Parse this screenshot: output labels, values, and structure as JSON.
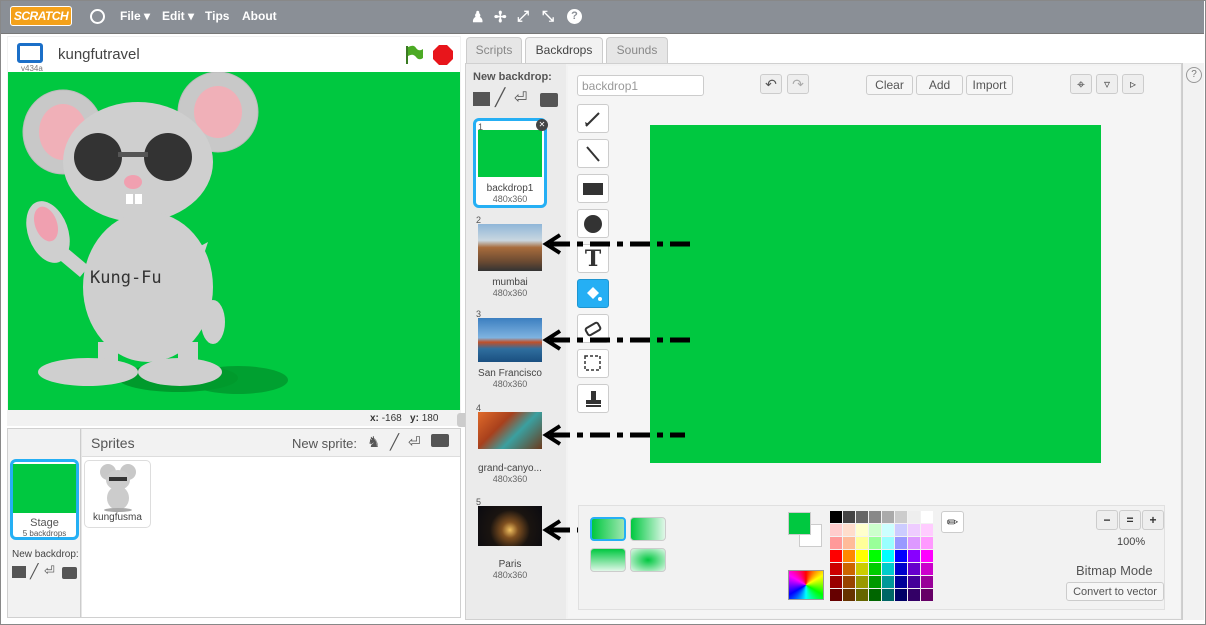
{
  "menubar": {
    "logo": "SCRATCH",
    "items": [
      "File ▾",
      "Edit ▾",
      "Tips",
      "About"
    ]
  },
  "stage": {
    "project_title": "kungfutravel",
    "version": "v434a",
    "sprite_text": "Kung-Fu",
    "coords_x_label": "x:",
    "coords_x": "-168",
    "coords_y_label": "y:",
    "coords_y": "180"
  },
  "sprites_panel": {
    "title": "Sprites",
    "new_sprite_label": "New sprite:",
    "stage_label": "Stage",
    "stage_backdrops": "5 backdrops",
    "new_backdrop_label": "New backdrop:",
    "sprites": [
      {
        "name": "kungfusma"
      }
    ]
  },
  "tabs": [
    "Scripts",
    "Backdrops",
    "Sounds"
  ],
  "backdrops_panel": {
    "new_backdrop_label": "New backdrop:",
    "items": [
      {
        "num": "1",
        "name": "backdrop1",
        "size": "480x360"
      },
      {
        "num": "2",
        "name": "mumbai",
        "size": "480x360"
      },
      {
        "num": "3",
        "name": "San Francisco",
        "size": "480x360"
      },
      {
        "num": "4",
        "name": "grand-canyo...",
        "size": "480x360"
      },
      {
        "num": "5",
        "name": "Paris",
        "size": "480x360"
      }
    ]
  },
  "paint_editor": {
    "name_value": "backdrop1",
    "clear_label": "Clear",
    "add_label": "Add",
    "import_label": "Import",
    "zoom_level": "100%",
    "mode_label": "Bitmap Mode",
    "convert_label": "Convert to vector",
    "canvas_color": "#00c840"
  },
  "colors": {
    "green": "#00c840",
    "accent_blue": "#25aff4"
  }
}
